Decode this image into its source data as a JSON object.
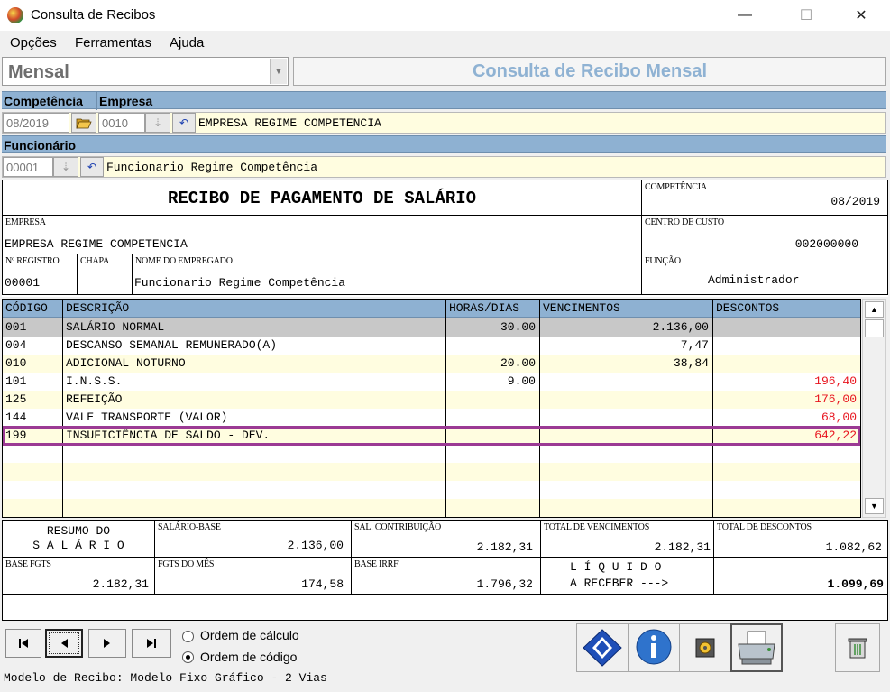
{
  "window": {
    "title": "Consulta de Recibos",
    "minimize": "—",
    "maximize": "☐",
    "close": "✕"
  },
  "menu": [
    "Opções",
    "Ferramentas",
    "Ajuda"
  ],
  "period_select": {
    "value": "Mensal",
    "arrow": "▼"
  },
  "header_title": "Consulta de Recibo Mensal",
  "filters": {
    "competencia_label": "Competência",
    "empresa_label": "Empresa",
    "competencia_value": "08/2019",
    "empresa_code": "0010",
    "empresa_name": "EMPRESA REGIME COMPETENCIA",
    "funcionario_label": "Funcionário",
    "funcionario_code": "00001",
    "funcionario_name": "Funcionario Regime Competência"
  },
  "recibo": {
    "title": "RECIBO DE PAGAMENTO DE SALÁRIO",
    "competencia_label": "COMPETÊNCIA",
    "competencia_value": "08/2019",
    "empresa_label": "EMPRESA",
    "empresa_value": "EMPRESA REGIME COMPETENCIA",
    "centro_label": "CENTRO DE CUSTO",
    "centro_value": "002000000",
    "registro_label": "Nº REGISTRO",
    "registro_value": "00001",
    "chapa_label": "CHAPA",
    "nome_label": "NOME DO EMPREGADO",
    "nome_value": "Funcionario Regime Competência",
    "funcao_label": "FUNÇÃO",
    "funcao_value": "Administrador"
  },
  "table": {
    "headers": [
      "CÓDIGO",
      "DESCRIÇÃO",
      "HORAS/DIAS",
      "VENCIMENTOS",
      "DESCONTOS"
    ],
    "rows": [
      {
        "codigo": "001",
        "descricao": "SALÁRIO NORMAL",
        "horas": "30.00",
        "vencimentos": "2.136,00",
        "descontos": ""
      },
      {
        "codigo": "004",
        "descricao": "DESCANSO SEMANAL REMUNERADO(A)",
        "horas": "",
        "vencimentos": "7,47",
        "descontos": ""
      },
      {
        "codigo": "010",
        "descricao": "ADICIONAL NOTURNO",
        "horas": "20.00",
        "vencimentos": "38,84",
        "descontos": ""
      },
      {
        "codigo": "101",
        "descricao": "I.N.S.S.",
        "horas": "9.00",
        "vencimentos": "",
        "descontos": "196,40"
      },
      {
        "codigo": "125",
        "descricao": "REFEIÇÃO",
        "horas": "",
        "vencimentos": "",
        "descontos": "176,00"
      },
      {
        "codigo": "144",
        "descricao": "VALE TRANSPORTE (VALOR)",
        "horas": "",
        "vencimentos": "",
        "descontos": "68,00"
      },
      {
        "codigo": "199",
        "descricao": "INSUFICIÊNCIA DE SALDO - DEV.",
        "horas": "",
        "vencimentos": "",
        "descontos": "642,22"
      }
    ],
    "selected_index": 0,
    "highlighted_index": 6,
    "desconto_color": "#e8141e",
    "highlight_color": "#9b3a94"
  },
  "summary": {
    "resumo_line1": "RESUMO DO",
    "resumo_line2": "S A L Á R I O",
    "salario_base_label": "SALÁRIO-BASE",
    "salario_base_value": "2.136,00",
    "sal_contrib_label": "SAL. CONTRIBUIÇÃO",
    "sal_contrib_value": "2.182,31",
    "total_venc_label": "TOTAL DE VENCIMENTOS",
    "total_venc_value": "2.182,31",
    "total_desc_label": "TOTAL DE DESCONTOS",
    "total_desc_value": "1.082,62",
    "base_fgts_label": "BASE FGTS",
    "base_fgts_value": "2.182,31",
    "fgts_mes_label": "FGTS DO MÊS",
    "fgts_mes_value": "174,58",
    "base_irrf_label": "BASE IRRF",
    "base_irrf_value": "1.796,32",
    "liquido_line1": "L Í Q U I D O",
    "liquido_line2": "A RECEBER --->",
    "liquido_value": "1.099,69"
  },
  "order": {
    "opcao_calculo": "Ordem de cálculo",
    "opcao_codigo": "Ordem de código",
    "selected": "codigo"
  },
  "status": "Modelo de Recibo: Modelo Fixo Gráfico - 2 Vias"
}
